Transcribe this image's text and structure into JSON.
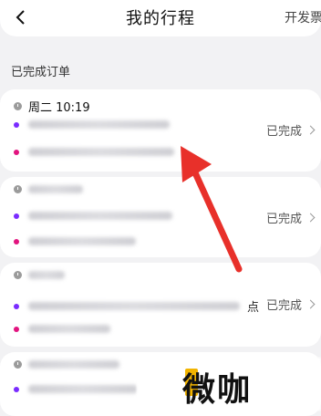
{
  "header": {
    "back_icon": "chevron-left-icon",
    "title": "我的行程",
    "invoice_label": "开发票"
  },
  "section_title": "已完成订单",
  "orders": [
    {
      "time": "周二 10:19",
      "status": "已完成"
    },
    {
      "time": "",
      "status": "已完成"
    },
    {
      "time": "",
      "status": "已完成",
      "trailing": "点"
    },
    {
      "time": "",
      "status": ""
    }
  ],
  "watermark": {
    "text": "微咖"
  },
  "colors": {
    "start_dot": "#7a2cff",
    "end_dot": "#e2147f",
    "arrow": "#e8302a",
    "watermark_accent": "#f2b400"
  }
}
